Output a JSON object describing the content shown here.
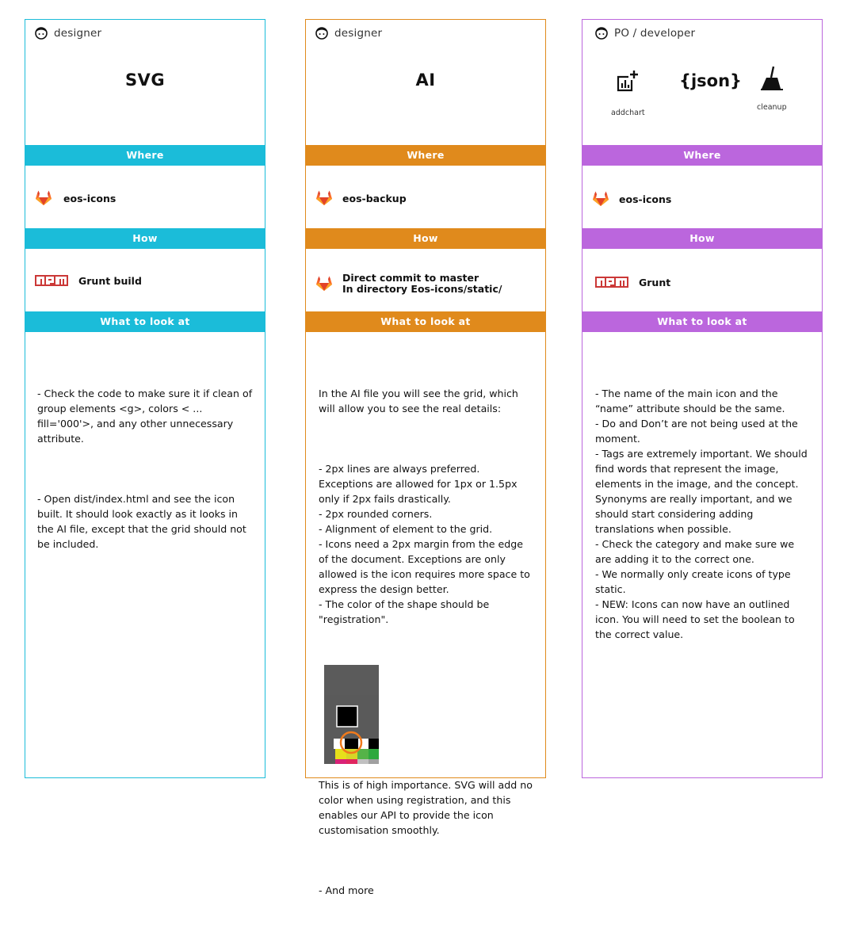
{
  "columns": [
    {
      "role": "designer",
      "title": "SVG",
      "color": "#1bbcd9",
      "where_header": "Where",
      "where_repo": "eos-icons",
      "how_header": "How",
      "how_text": "Grunt build",
      "look_header": "What to look at",
      "paragraphs": [
        "- Check the code to make sure it if clean of group elements <g>, colors < ... fill='000'>, and any other unnecessary attribute.",
        "- Open dist/index.html and see the icon built. It should look exactly as it looks in the AI file, except that the grid should not be included."
      ]
    },
    {
      "role": "designer",
      "title": "AI",
      "color": "#e08a1c",
      "where_header": "Where",
      "where_repo": "eos-backup",
      "how_header": "How",
      "how_text_1": "Direct commit to master",
      "how_text_2": "In directory Eos-icons/static/",
      "look_header": "What to look at",
      "paragraphs": [
        "In the AI file you will see the grid, which will allow you to see the real details:",
        "- 2px lines are always preferred. Exceptions are allowed for 1px or 1.5px only if 2px fails drastically.\n- 2px rounded corners.\n- Alignment of element to the grid.\n- Icons need a 2px margin from the edge of the document. Exceptions are only allowed is the icon requires more space to express the design better.\n- The color of the shape should be \"registration\"."
      ],
      "after_paragraphs": [
        "This is of high importance. SVG will add no color when using registration, and this enables our API to provide the icon customisation smoothly.",
        "- And more"
      ]
    },
    {
      "role": "PO / developer",
      "color": "#bb66dd",
      "icons": [
        {
          "name": "addchart-icon",
          "label": "addchart"
        },
        {
          "name": "json-icon",
          "label": "{json}"
        },
        {
          "name": "cleanup-icon",
          "label": "cleanup"
        }
      ],
      "where_header": "Where",
      "where_repo": "eos-icons",
      "how_header": "How",
      "how_text": "Grunt",
      "look_header": "What to look at",
      "paragraphs": [
        "- The name of the main icon and the “name” attribute should be the same.\n- Do and Don’t are not being used at the moment.\n- Tags are extremely important. We should find words that represent the image, elements in the image, and the concept. Synonyms are really important, and we should start considering adding translations when possible.\n- Check the category and make sure we are adding it to the correct one.\n- We normally only create icons of type static.\n- NEW: Icons can now have an outlined icon. You will need to set the boolean to the correct value."
      ]
    }
  ]
}
